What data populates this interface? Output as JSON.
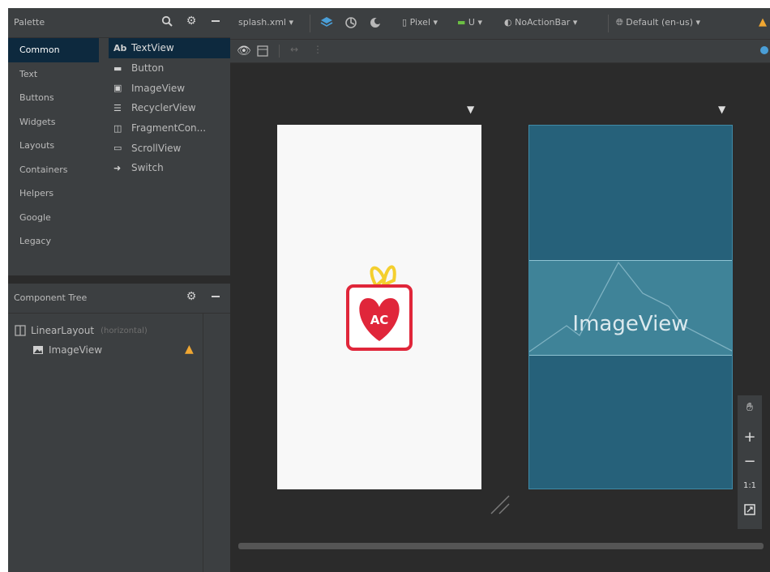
{
  "palette": {
    "title": "Palette",
    "categories": [
      "Common",
      "Text",
      "Buttons",
      "Widgets",
      "Layouts",
      "Containers",
      "Helpers",
      "Google",
      "Legacy"
    ],
    "items": [
      {
        "glyph": "Ab",
        "label": "TextView"
      },
      {
        "glyph": "▬",
        "label": "Button"
      },
      {
        "glyph": "▣",
        "label": "ImageView"
      },
      {
        "glyph": "☰",
        "label": "RecyclerView"
      },
      {
        "glyph": "◫",
        "label": "FragmentCon..."
      },
      {
        "glyph": "▭",
        "label": "ScrollView"
      },
      {
        "glyph": "➜",
        "label": "Switch"
      }
    ]
  },
  "component_tree": {
    "title": "Component Tree",
    "root": {
      "label": "LinearLayout",
      "orientation": "(horizontal)"
    },
    "child": {
      "label": "ImageView"
    }
  },
  "toolbar": {
    "file": "splash.xml ▾",
    "device": "Pixel ▾",
    "api": "U ▾",
    "theme": "NoActionBar ▾",
    "locale": "Default (en-us) ▾"
  },
  "canvas": {
    "blueprint_label": "ImageView",
    "logo_text": "AC"
  },
  "colors": {
    "accent_blue": "#0d293e",
    "blueprint": "#26617a",
    "warning": "#f0a732",
    "logo_red": "#e0263a",
    "logo_yellow": "#f4cf2e"
  }
}
